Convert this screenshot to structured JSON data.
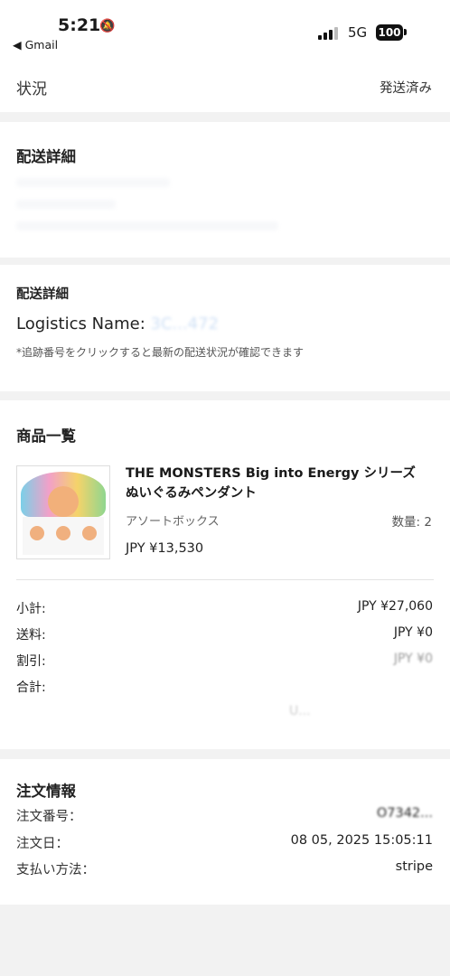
{
  "status_bar": {
    "time": "5:21",
    "back_app": "Gmail",
    "network": "5G",
    "battery": "100"
  },
  "status_section": {
    "label": "状況",
    "value": "発送済み"
  },
  "shipping_details": {
    "title": "配送詳細"
  },
  "logistics": {
    "title": "配送詳細",
    "name_label": "Logistics Name:",
    "name_value": "3C...472",
    "note": "*追跡番号をクリックすると最新の配送状況が確認できます"
  },
  "products": {
    "title": "商品一覧",
    "items": [
      {
        "name": "THE MONSTERS Big into Energy シリーズ ぬいぐるみペンダント",
        "variant": "アソートボックス",
        "quantity": "数量: 2",
        "price": "JPY ¥13,530"
      }
    ],
    "summary": [
      {
        "label": "小計:",
        "value": "JPY ¥27,060"
      },
      {
        "label": "送料:",
        "value": "JPY ¥0"
      },
      {
        "label": "割引:",
        "value": "JPY ¥0"
      },
      {
        "label": "合計:",
        "value": ""
      }
    ],
    "total_partial": "U..."
  },
  "order_info": {
    "title": "注文情報",
    "rows": [
      {
        "label": "注文番号：",
        "value": "O7342..."
      },
      {
        "label": "注文日：",
        "value": "08 05, 2025 15:05:11"
      },
      {
        "label": "支払い方法：",
        "value": "stripe"
      }
    ]
  }
}
